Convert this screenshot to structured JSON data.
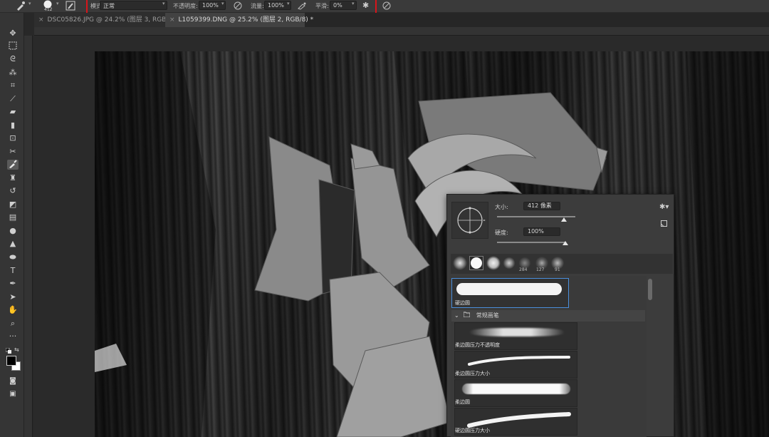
{
  "options_bar": {
    "brush_size": "412",
    "mode_label": "模式:",
    "mode_value": "正常",
    "opacity_label": "不透明度:",
    "opacity_value": "100%",
    "flow_label": "流量:",
    "flow_value": "100%",
    "smoothing_label": "平滑:",
    "smoothing_value": "0%",
    "highlight_color": "#d8151b"
  },
  "tabs": [
    {
      "label": "DSC05826.JPG @ 24.2% (图层 3, RGB/8) *",
      "active": false
    },
    {
      "label": "L1059399.DNG @ 25.2% (图层 2, RGB/8) *",
      "active": true
    }
  ],
  "brush_panel": {
    "size_label": "大小:",
    "size_value": "412 像素",
    "hardness_label": "硬度:",
    "hardness_value": "100%",
    "size_slider_fraction": 0.85,
    "hardness_slider_fraction": 1.0,
    "preset_numbers": [
      "284",
      "127",
      "91"
    ],
    "selected_brush": "硬边圆",
    "group_name": "常规画笔",
    "brushes": [
      "柔边圆压力不透明度",
      "柔边圆压力大小",
      "柔边圆",
      "硬边圆压力大小"
    ]
  }
}
